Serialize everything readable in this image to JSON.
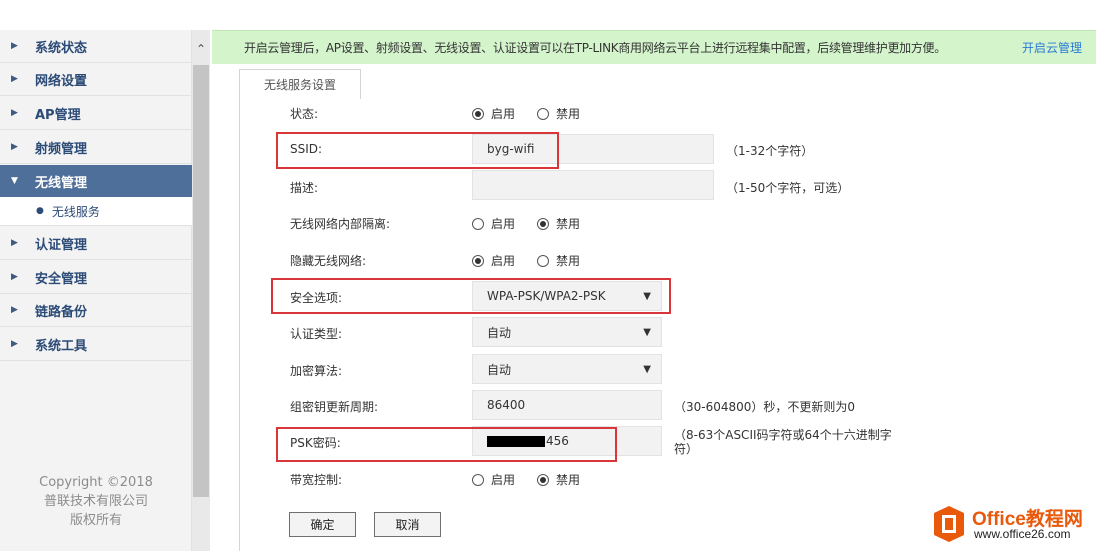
{
  "sidebar": {
    "items": [
      {
        "label": "系统状态"
      },
      {
        "label": "网络设置"
      },
      {
        "label": "AP管理"
      },
      {
        "label": "射频管理"
      },
      {
        "label": "无线管理"
      },
      {
        "label": "认证管理"
      },
      {
        "label": "安全管理"
      },
      {
        "label": "链路备份"
      },
      {
        "label": "系统工具"
      }
    ],
    "active_item": "无线管理",
    "sub_item": "无线服务",
    "copyright": {
      "line1": "Copyright ©2018",
      "line2": "普联技术有限公司",
      "line3": "版权所有"
    }
  },
  "notice": {
    "text": "开启云管理后，AP设置、射频设置、无线设置、认证设置可以在TP-LINK商用网络云平台上进行远程集中配置，后续管理维护更加方便。",
    "link": "开启云管理"
  },
  "tab": {
    "label": "无线服务设置"
  },
  "form": {
    "status": {
      "label": "状态:",
      "options": [
        "启用",
        "禁用"
      ],
      "selected": "启用"
    },
    "ssid": {
      "label": "SSID:",
      "value": "byg-wifi",
      "hint": "（1-32个字符）"
    },
    "description": {
      "label": "描述:",
      "value": "",
      "hint": "（1-50个字符，可选）"
    },
    "isolation": {
      "label": "无线网络内部隔离:",
      "options": [
        "启用",
        "禁用"
      ],
      "selected": "禁用"
    },
    "hide_network": {
      "label": "隐藏无线网络:",
      "options": [
        "启用",
        "禁用"
      ],
      "selected": "启用"
    },
    "security": {
      "label": "安全选项:",
      "value": "WPA-PSK/WPA2-PSK"
    },
    "auth_type": {
      "label": "认证类型:",
      "value": "自动"
    },
    "encryption": {
      "label": "加密算法:",
      "value": "自动"
    },
    "rekey": {
      "label": "组密钥更新周期:",
      "value": "86400",
      "hint": "（30-604800）秒，不更新则为0"
    },
    "psk": {
      "label": "PSK密码:",
      "value_suffix": "456",
      "hint_line1": "（8-63个ASCII码字符或64个十六进制字",
      "hint_line2": "符）"
    },
    "bandwidth": {
      "label": "带宽控制:",
      "options": [
        "启用",
        "禁用"
      ],
      "selected": "禁用"
    }
  },
  "buttons": {
    "ok": "确定",
    "cancel": "取消"
  },
  "watermark": {
    "title": "Office教程网",
    "url": "www.office26.com"
  },
  "colors": {
    "active_nav": "#4e6f99",
    "nav_text": "#2c4b77",
    "notice_bg": "#d4f4cc",
    "highlight": "#d9363a",
    "link": "#2a7ad6"
  }
}
